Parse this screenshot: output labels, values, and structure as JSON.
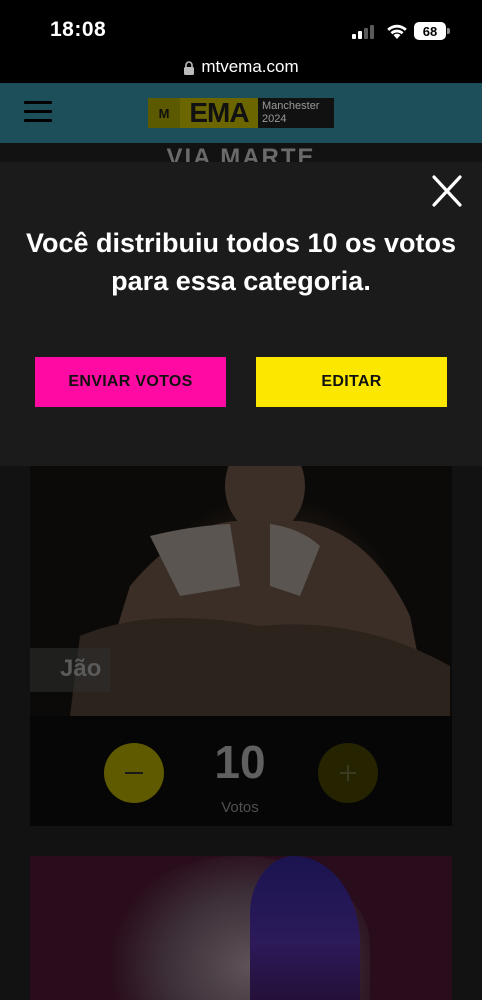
{
  "status_bar": {
    "time": "18:08",
    "battery": "68"
  },
  "browser": {
    "url": "mtvema.com"
  },
  "header": {
    "logo_mtv": "M",
    "logo_ema": "EMA",
    "logo_city": "Manchester",
    "logo_year": "2024"
  },
  "page": {
    "sponsor": "VIA MARTE",
    "artist_name": "Jão",
    "votes_count": "10",
    "votes_label": "Votos"
  },
  "modal": {
    "message": "Você distribuiu todos 10 os votos para essa categoria.",
    "send_button": "ENVIAR VOTOS",
    "edit_button": "EDITAR"
  },
  "colors": {
    "send_button": "#ff0aa2",
    "edit_button": "#fbe700",
    "modal_bg": "#1b1b1b",
    "header_bg": "#1d4f5a"
  },
  "icons": [
    "signal-icon",
    "wifi-icon",
    "battery-icon",
    "lock-icon",
    "hamburger-menu-icon",
    "close-icon",
    "minus-icon",
    "plus-icon"
  ]
}
